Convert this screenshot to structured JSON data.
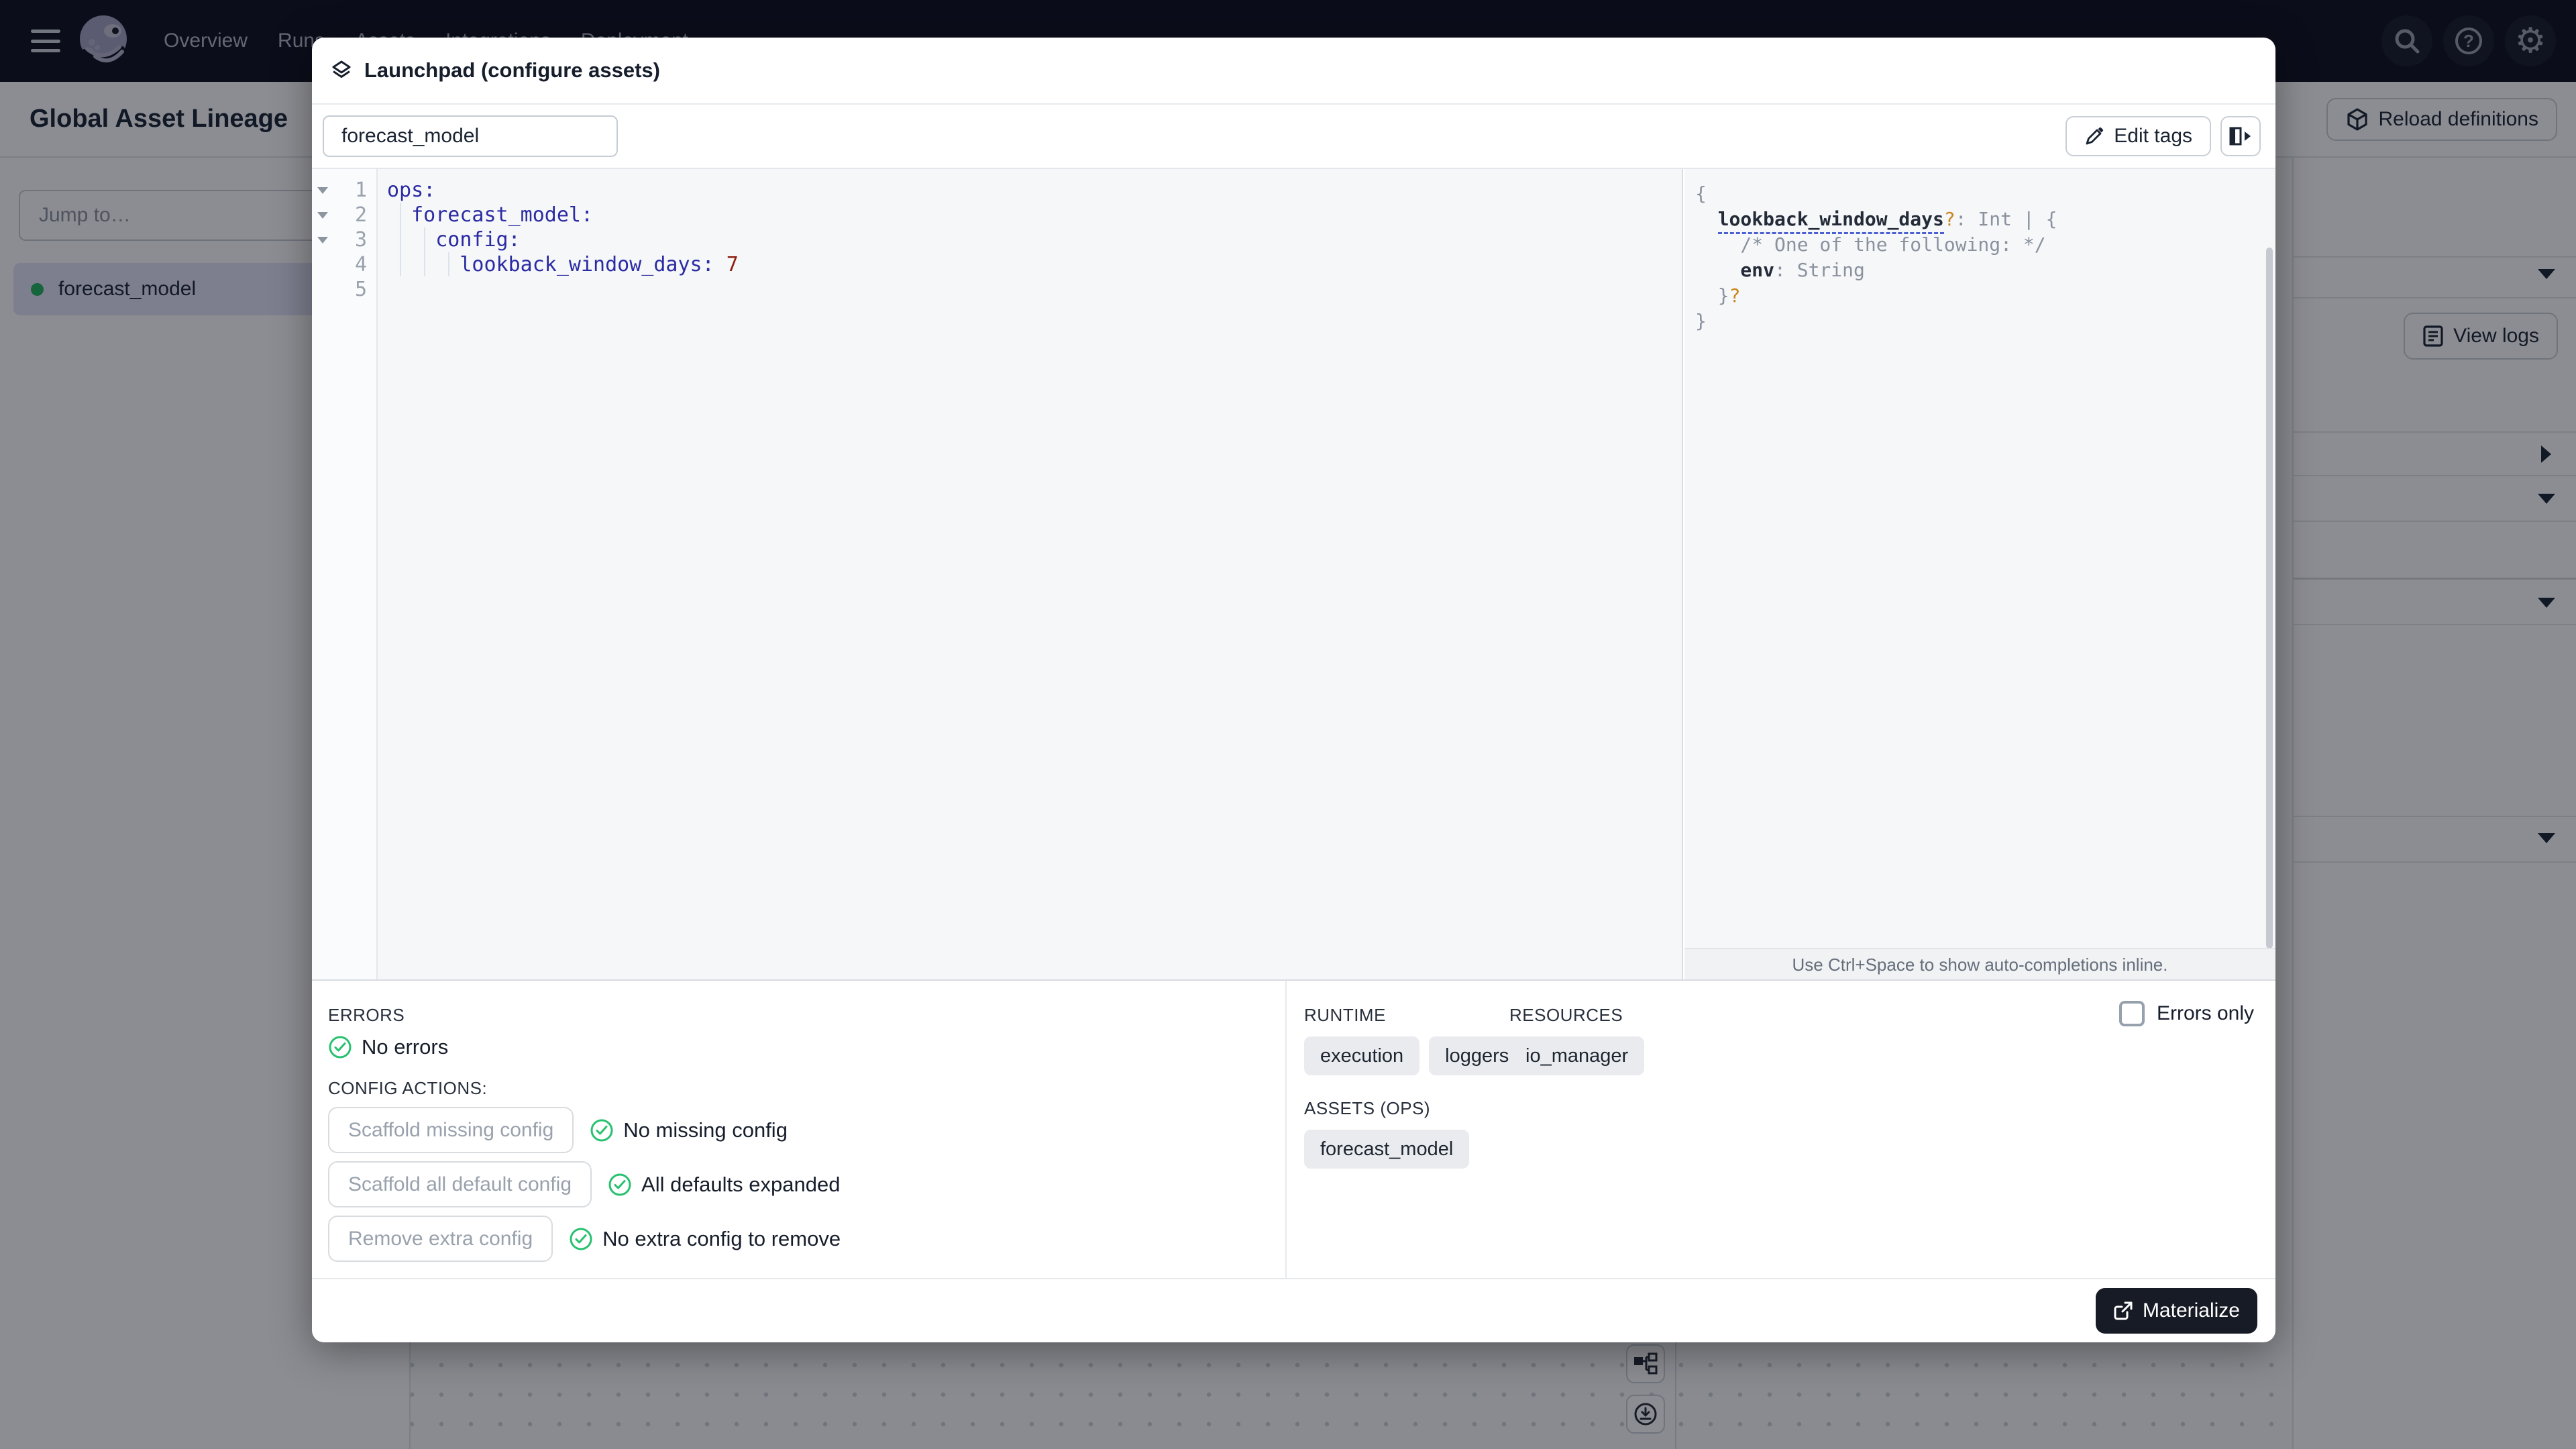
{
  "colors": {
    "nav_bg": "#0c101e",
    "accent_green": "#23b35f",
    "check_green": "#27c16f",
    "yaml_key_blue": "#2b2ba3",
    "yaml_number_red": "#8f2012",
    "schema_orange": "#c8861c",
    "materialize_bg": "#171b26",
    "selection_lavender": "#e2e3f7"
  },
  "icons": {
    "gear": "⚙",
    "help": "?"
  },
  "nav": {
    "items": [
      "Overview",
      "Runs",
      "Assets",
      "Integrations",
      "Deployment"
    ]
  },
  "page": {
    "title": "Global Asset Lineage",
    "reload_button": "Reload definitions",
    "jump_placeholder": "Jump to…",
    "asset_item": "forecast_model",
    "view_logs": "View logs"
  },
  "modal": {
    "title": "Launchpad (configure assets)",
    "session_tab": "forecast_model",
    "edit_tags": "Edit tags",
    "editor": {
      "lines": [
        {
          "n": "1",
          "code": "ops:"
        },
        {
          "n": "2",
          "code": "  forecast_model:"
        },
        {
          "n": "3",
          "code": "    config:"
        },
        {
          "n": "4",
          "code": "      lookback_window_days: ",
          "value": "7"
        },
        {
          "n": "5",
          "code": ""
        }
      ]
    },
    "schema": {
      "open": "{",
      "prop": "lookback_window_days",
      "q1": "?",
      "prop_rest": ": Int | {",
      "comment": "/* One of the following: */",
      "env_key": "env",
      "env_type": ": String",
      "close_inner": "}",
      "q2": "?",
      "close": "}",
      "hint": "Use Ctrl+Space to show auto-completions inline."
    },
    "errors": {
      "label": "ERRORS",
      "status": "No errors"
    },
    "config_actions": {
      "label": "CONFIG ACTIONS:",
      "rows": [
        {
          "button": "Scaffold missing config",
          "status": "No missing config"
        },
        {
          "button": "Scaffold all default config",
          "status": "All defaults expanded"
        },
        {
          "button": "Remove extra config",
          "status": "No extra config to remove"
        }
      ]
    },
    "runtime": {
      "label": "RUNTIME",
      "tags": [
        "execution",
        "loggers"
      ]
    },
    "resources": {
      "label": "RESOURCES",
      "tags": [
        "io_manager"
      ]
    },
    "assets_ops": {
      "label": "ASSETS (OPS)",
      "tags": [
        "forecast_model"
      ]
    },
    "errors_only_label": "Errors only",
    "materialize": "Materialize"
  }
}
